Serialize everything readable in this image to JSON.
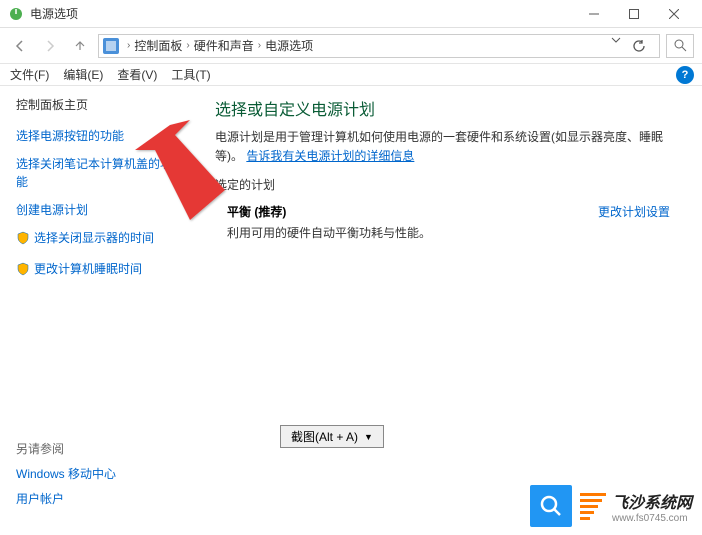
{
  "window": {
    "title": "电源选项"
  },
  "breadcrumb": {
    "items": [
      "控制面板",
      "硬件和声音",
      "电源选项"
    ]
  },
  "menu": {
    "file": "文件(F)",
    "edit": "编辑(E)",
    "view": "查看(V)",
    "tools": "工具(T)"
  },
  "sidebar": {
    "home": "控制面板主页",
    "links": [
      "选择电源按钮的功能",
      "选择关闭笔记本计算机盖的功能",
      "创建电源计划",
      "选择关闭显示器的时间",
      "更改计算机睡眠时间"
    ],
    "see_also_title": "另请参阅",
    "see_also": [
      "Windows 移动中心",
      "用户帐户"
    ]
  },
  "main": {
    "title": "选择或自定义电源计划",
    "desc_prefix": "电源计划是用于管理计算机如何使用电源的一套硬件和系统设置(如显示器亮度、睡眠等)。",
    "desc_link": "告诉我有关电源计划的详细信息",
    "section": "选定的计划",
    "plan_name": "平衡 (推荐)",
    "plan_desc": "利用可用的硬件自动平衡功耗与性能。",
    "plan_settings": "更改计划设置"
  },
  "capture": {
    "label": "截图(Alt + A)"
  },
  "watermark": {
    "brand": "飞沙系统网",
    "url": "www.fs0745.com"
  }
}
